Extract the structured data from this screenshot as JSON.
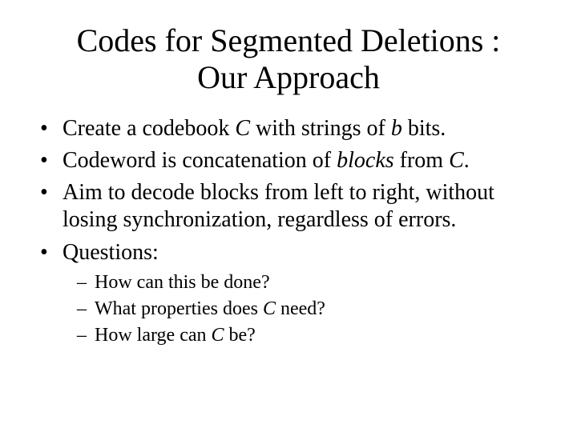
{
  "title_line1": "Codes for Segmented Deletions :",
  "title_line2": "Our Approach",
  "b1": {
    "a": "Create a codebook ",
    "C": "C",
    "b": " with strings of ",
    "bvar": "b",
    "c": " bits."
  },
  "b2": {
    "a": "Codeword is concatenation of ",
    "blocks": "blocks",
    "b": " from ",
    "C": "C",
    "c": "."
  },
  "b3": "Aim to decode blocks from left to right, without losing synchronization, regardless of errors.",
  "b4": "Questions:",
  "s1": "How can this be done?",
  "s2": {
    "a": "What properties does ",
    "C": "C",
    "b": " need?"
  },
  "s3": {
    "a": "How large can ",
    "C": "C",
    "b": " be?"
  }
}
